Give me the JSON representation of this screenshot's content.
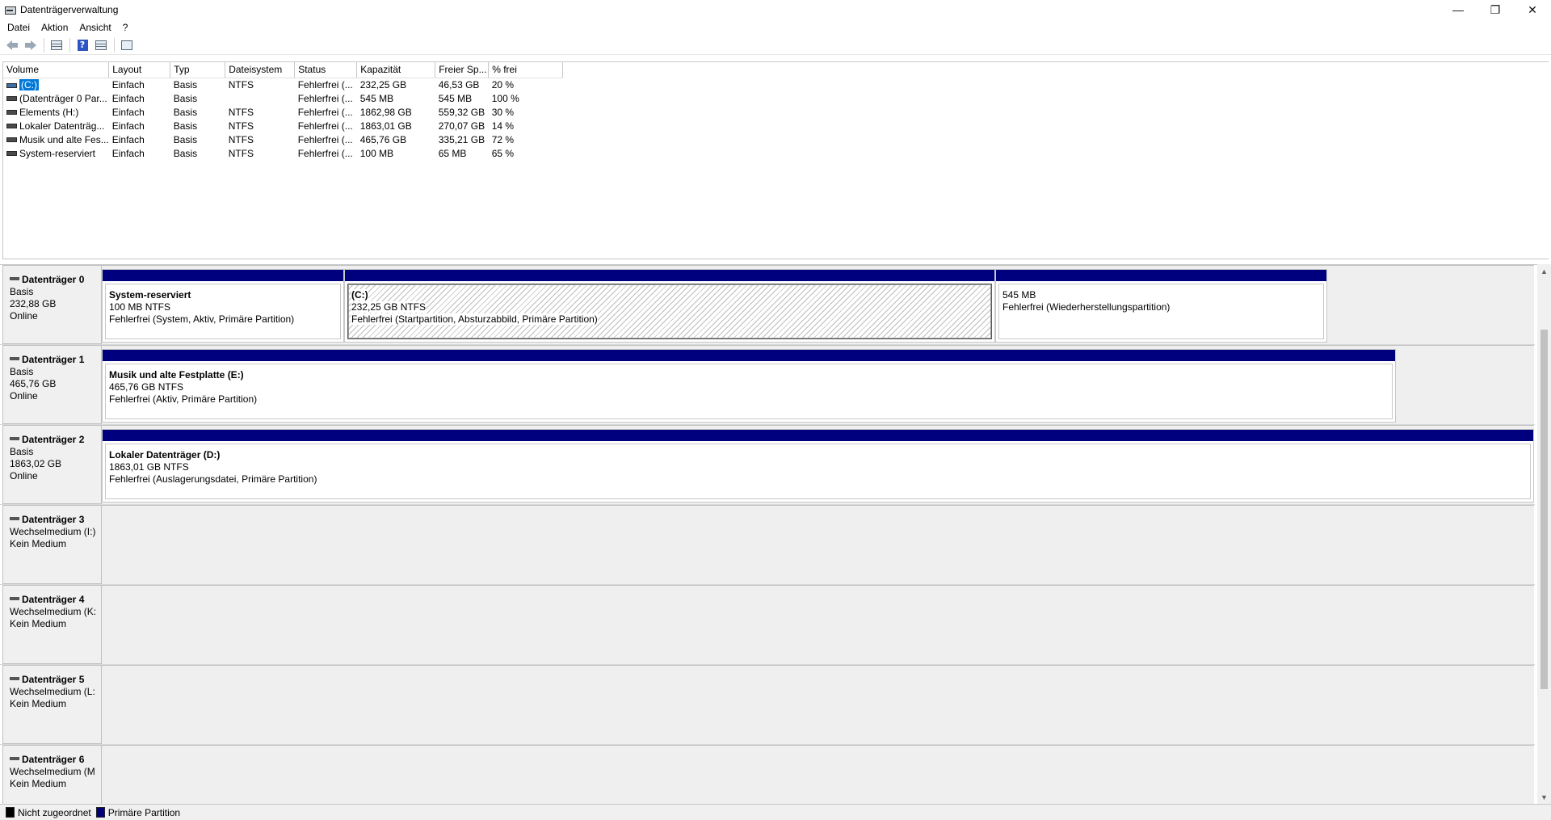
{
  "window": {
    "title": "Datenträgerverwaltung",
    "minimize": "—",
    "maximize": "❐",
    "close": "✕"
  },
  "menu": [
    "Datei",
    "Aktion",
    "Ansicht",
    "?"
  ],
  "toolbar": [
    {
      "icon": "back-arrow-icon"
    },
    {
      "icon": "forward-arrow-icon"
    },
    {
      "icon": "console-tree-icon"
    },
    {
      "icon": "help-icon"
    },
    {
      "icon": "properties-icon"
    },
    {
      "icon": "view-icon"
    }
  ],
  "volume_table": {
    "columns": [
      "Volume",
      "Layout",
      "Typ",
      "Dateisystem",
      "Status",
      "Kapazität",
      "Freier Sp...",
      "% frei"
    ],
    "rows": [
      {
        "volume": "(C:)",
        "layout": "Einfach",
        "typ": "Basis",
        "fs": "NTFS",
        "status": "Fehlerfrei (...",
        "capacity": "232,25 GB",
        "free": "46,53 GB",
        "pct": "20 %",
        "selected": true
      },
      {
        "volume": "(Datenträger 0 Par...",
        "layout": "Einfach",
        "typ": "Basis",
        "fs": "",
        "status": "Fehlerfrei (...",
        "capacity": "545 MB",
        "free": "545 MB",
        "pct": "100 %"
      },
      {
        "volume": "Elements (H:)",
        "layout": "Einfach",
        "typ": "Basis",
        "fs": "NTFS",
        "status": "Fehlerfrei (...",
        "capacity": "1862,98 GB",
        "free": "559,32 GB",
        "pct": "30 %"
      },
      {
        "volume": "Lokaler Datenträg...",
        "layout": "Einfach",
        "typ": "Basis",
        "fs": "NTFS",
        "status": "Fehlerfrei (...",
        "capacity": "1863,01 GB",
        "free": "270,07 GB",
        "pct": "14 %"
      },
      {
        "volume": "Musik und alte Fes...",
        "layout": "Einfach",
        "typ": "Basis",
        "fs": "NTFS",
        "status": "Fehlerfrei (...",
        "capacity": "465,76 GB",
        "free": "335,21 GB",
        "pct": "72 %"
      },
      {
        "volume": "System-reserviert",
        "layout": "Einfach",
        "typ": "Basis",
        "fs": "NTFS",
        "status": "Fehlerfrei (...",
        "capacity": "100 MB",
        "free": "65 MB",
        "pct": "65 %"
      }
    ]
  },
  "disks": [
    {
      "name": "Datenträger 0",
      "line2": "Basis",
      "line3": "232,88 GB",
      "line4": "Online",
      "partitions": [
        {
          "name": "System-reserviert",
          "size": "100 MB NTFS",
          "status": "Fehlerfrei (System, Aktiv, Primäre Partition)"
        },
        {
          "name": "(C:)",
          "size": "232,25 GB NTFS",
          "status": "Fehlerfrei (Startpartition, Absturzabbild, Primäre Partition)",
          "selected": true
        },
        {
          "name": "",
          "size": "545 MB",
          "status": "Fehlerfrei (Wiederherstellungspartition)"
        }
      ]
    },
    {
      "name": "Datenträger 1",
      "line2": "Basis",
      "line3": "465,76 GB",
      "line4": "Online",
      "partitions": [
        {
          "name": "Musik und alte Festplatte  (E:)",
          "size": "465,76 GB NTFS",
          "status": "Fehlerfrei (Aktiv, Primäre Partition)"
        }
      ]
    },
    {
      "name": "Datenträger 2",
      "line2": "Basis",
      "line3": "1863,02 GB",
      "line4": "Online",
      "partitions": [
        {
          "name": "Lokaler Datenträger  (D:)",
          "size": "1863,01 GB NTFS",
          "status": "Fehlerfrei (Auslagerungsdatei, Primäre Partition)"
        }
      ]
    },
    {
      "name": "Datenträger 3",
      "line2": "Wechselmedium (I:)",
      "line3": "",
      "line4": "Kein Medium",
      "partitions": []
    },
    {
      "name": "Datenträger 4",
      "line2": "Wechselmedium (K:",
      "line3": "",
      "line4": "Kein Medium",
      "partitions": []
    },
    {
      "name": "Datenträger 5",
      "line2": "Wechselmedium (L:",
      "line3": "",
      "line4": "Kein Medium",
      "partitions": []
    },
    {
      "name": "Datenträger 6",
      "line2": "Wechselmedium (M",
      "line3": "",
      "line4": "Kein Medium",
      "partitions": []
    }
  ],
  "legend": [
    {
      "label": "Nicht zugeordnet",
      "color": "#000000"
    },
    {
      "label": "Primäre Partition",
      "color": "#00007f"
    }
  ]
}
